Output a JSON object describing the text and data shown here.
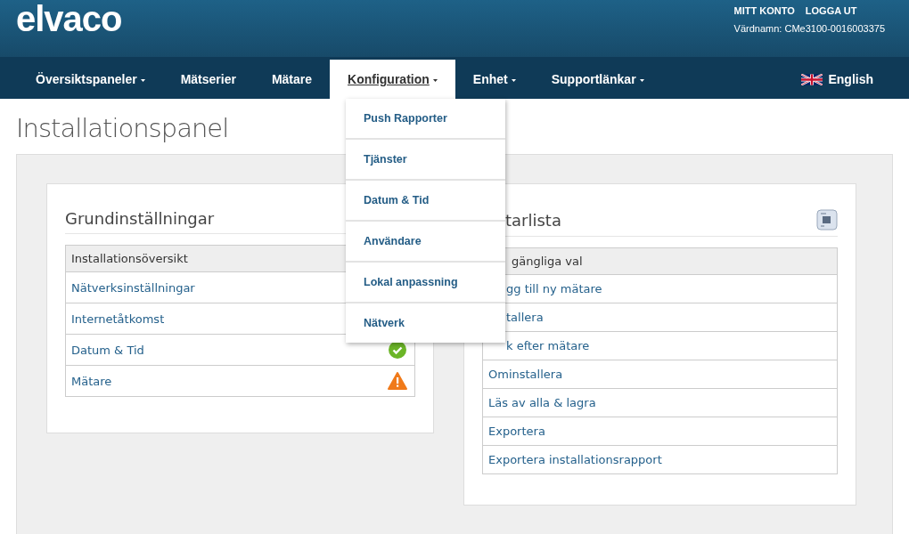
{
  "brand": {
    "logo": "elvaco"
  },
  "account": {
    "links": [
      "MITT KONTO",
      "LOGGA UT"
    ],
    "hostname": "Värdnamn: CMe3100-0016003375"
  },
  "nav": [
    {
      "label": "Översiktspaneler",
      "caret": true,
      "selected": false
    },
    {
      "label": "Mätserier",
      "caret": false,
      "selected": false
    },
    {
      "label": "Mätare",
      "caret": false,
      "selected": false
    },
    {
      "label": "Konfiguration",
      "caret": true,
      "selected": true
    },
    {
      "label": "Enhet",
      "caret": true,
      "selected": false
    },
    {
      "label": "Supportlänkar",
      "caret": true,
      "selected": false
    }
  ],
  "language": {
    "label": "English"
  },
  "dropdown": [
    "Push Rapporter",
    "Tjänster",
    "Datum & Tid",
    "Användare",
    "Lokal anpassning",
    "Nätverk"
  ],
  "page_title": "Installationspanel",
  "basic_settings": {
    "title": "Grundinställningar",
    "header": "Installationsöversikt",
    "rows": [
      {
        "label": "Nätverksinställningar",
        "kind": "plain"
      },
      {
        "label": "Internetåtkomst",
        "kind": "plain"
      },
      {
        "label": "Datum & Tid",
        "kind": "ok"
      },
      {
        "label": "Mätare",
        "kind": "warning"
      }
    ]
  },
  "meter_list": {
    "title": "tarlista",
    "header": "gängliga val",
    "rows": [
      {
        "label": "gg till ny mätare",
        "partial": true
      },
      {
        "label": "tallera",
        "partial": true
      },
      {
        "label": "k efter mätare",
        "partial": true
      },
      {
        "label": "Ominstallera",
        "partial": false
      },
      {
        "label": "Läs av alla & lagra",
        "partial": false
      },
      {
        "label": "Exportera",
        "partial": false
      },
      {
        "label": "Exportera installationsrapport",
        "partial": false
      }
    ]
  }
}
